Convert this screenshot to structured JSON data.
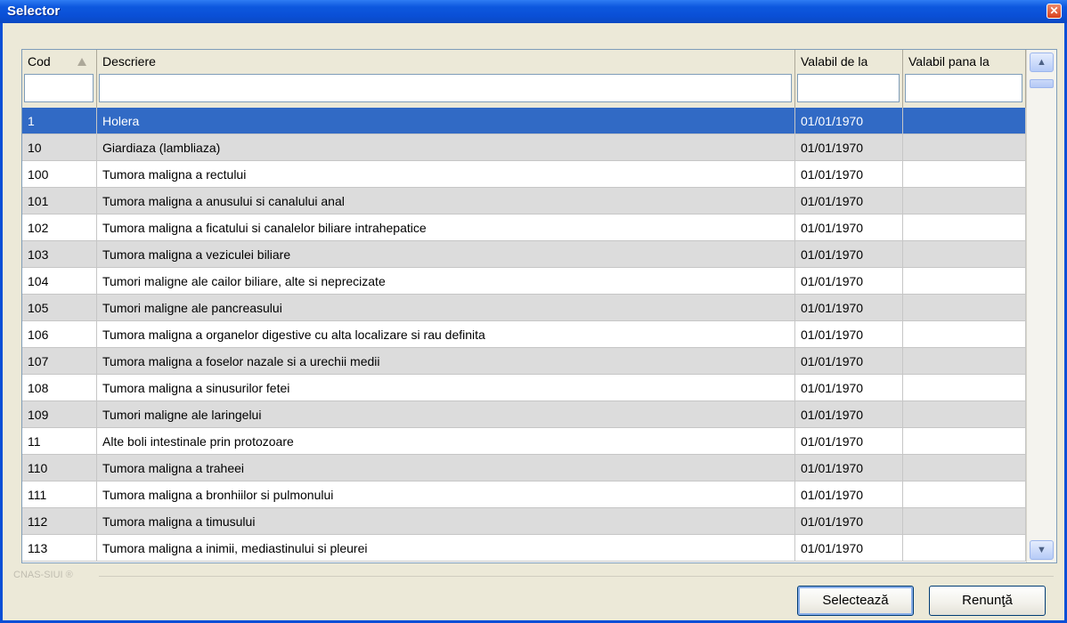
{
  "window": {
    "title": "Selector",
    "close_glyph": "✕"
  },
  "grid": {
    "columns": [
      {
        "key": "cod",
        "label": "Cod"
      },
      {
        "key": "descriere",
        "label": "Descriere"
      },
      {
        "key": "valabil_de_la",
        "label": "Valabil de la"
      },
      {
        "key": "valabil_pana_la",
        "label": "Valabil pana la"
      }
    ],
    "sort": {
      "column": "cod",
      "direction": "ascending"
    },
    "filters": {
      "cod": "",
      "descriere": "",
      "valabil_de_la": "",
      "valabil_pana_la": ""
    },
    "selected_index": 0,
    "rows": [
      {
        "cod": "1",
        "descriere": "Holera",
        "valabil_de_la": "01/01/1970",
        "valabil_pana_la": ""
      },
      {
        "cod": "10",
        "descriere": "Giardiaza (lambliaza)",
        "valabil_de_la": "01/01/1970",
        "valabil_pana_la": ""
      },
      {
        "cod": "100",
        "descriere": "Tumora maligna a rectului",
        "valabil_de_la": "01/01/1970",
        "valabil_pana_la": ""
      },
      {
        "cod": "101",
        "descriere": "Tumora maligna a anusului si canalului anal",
        "valabil_de_la": "01/01/1970",
        "valabil_pana_la": ""
      },
      {
        "cod": "102",
        "descriere": "Tumora maligna a ficatului si canalelor biliare intrahepatice",
        "valabil_de_la": "01/01/1970",
        "valabil_pana_la": ""
      },
      {
        "cod": "103",
        "descriere": "Tumora maligna a veziculei biliare",
        "valabil_de_la": "01/01/1970",
        "valabil_pana_la": ""
      },
      {
        "cod": "104",
        "descriere": "Tumori maligne ale cailor biliare, alte si neprecizate",
        "valabil_de_la": "01/01/1970",
        "valabil_pana_la": ""
      },
      {
        "cod": "105",
        "descriere": "Tumori maligne ale pancreasului",
        "valabil_de_la": "01/01/1970",
        "valabil_pana_la": ""
      },
      {
        "cod": "106",
        "descriere": "Tumora maligna a organelor digestive cu alta localizare si rau definita",
        "valabil_de_la": "01/01/1970",
        "valabil_pana_la": ""
      },
      {
        "cod": "107",
        "descriere": "Tumora maligna a foselor nazale si a urechii medii",
        "valabil_de_la": "01/01/1970",
        "valabil_pana_la": ""
      },
      {
        "cod": "108",
        "descriere": "Tumora maligna a sinusurilor fetei",
        "valabil_de_la": "01/01/1970",
        "valabil_pana_la": ""
      },
      {
        "cod": "109",
        "descriere": "Tumori maligne ale laringelui",
        "valabil_de_la": "01/01/1970",
        "valabil_pana_la": ""
      },
      {
        "cod": "11",
        "descriere": "Alte boli intestinale prin protozoare",
        "valabil_de_la": "01/01/1970",
        "valabil_pana_la": ""
      },
      {
        "cod": "110",
        "descriere": "Tumora maligna a traheei",
        "valabil_de_la": "01/01/1970",
        "valabil_pana_la": ""
      },
      {
        "cod": "111",
        "descriere": "Tumora maligna a bronhiilor si pulmonului",
        "valabil_de_la": "01/01/1970",
        "valabil_pana_la": ""
      },
      {
        "cod": "112",
        "descriere": "Tumora maligna a timusului",
        "valabil_de_la": "01/01/1970",
        "valabil_pana_la": ""
      },
      {
        "cod": "113",
        "descriere": "Tumora maligna a inimii, mediastinului si pleurei",
        "valabil_de_la": "01/01/1970",
        "valabil_pana_la": ""
      }
    ]
  },
  "scrollbar": {
    "up_glyph": "▲",
    "down_glyph": "▼"
  },
  "footer": {
    "brand": "CNAS-SIUI ®",
    "select_label": "Selectează",
    "cancel_label": "Renunţă"
  },
  "colors": {
    "selection": "#316ac5",
    "title_bar": "#0a4fd6",
    "alt_row": "#dcdcdc"
  }
}
